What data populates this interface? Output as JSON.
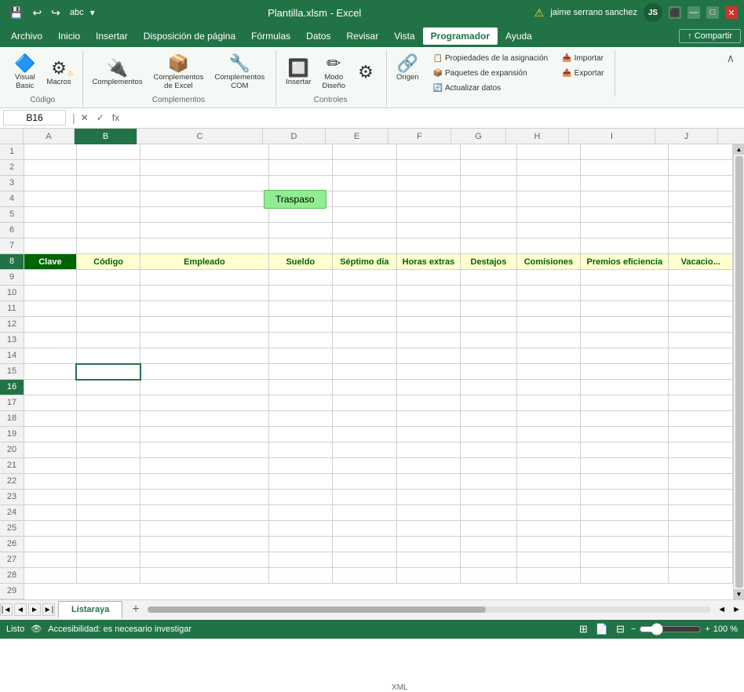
{
  "titlebar": {
    "title": "Plantilla.xlsm - Excel",
    "quick_access": [
      "💾",
      "↩",
      "↪",
      "abc"
    ],
    "user": "jaime serrano sanchez",
    "user_initials": "JS",
    "warning": "⚠",
    "minimize": "—",
    "maximize": "□",
    "close": "✕"
  },
  "menubar": {
    "items": [
      "Archivo",
      "Inicio",
      "Insertar",
      "Disposición de página",
      "Fórmulas",
      "Datos",
      "Revisar",
      "Vista",
      "Programador",
      "Ayuda"
    ],
    "active": "Programador",
    "share_label": "Compartir"
  },
  "ribbon": {
    "groups": [
      {
        "name": "Código",
        "buttons": [
          {
            "icon": "🔷",
            "label": "Visual\nBasic"
          },
          {
            "icon": "⚙",
            "label": "Macros",
            "warning": true
          }
        ]
      },
      {
        "name": "Complementos",
        "buttons": [
          {
            "icon": "🔌",
            "label": "Complementos"
          },
          {
            "icon": "📦",
            "label": "Complementos\nde Excel"
          },
          {
            "icon": "🔧",
            "label": "Complementos\nCOM"
          }
        ]
      },
      {
        "name": "Controles",
        "buttons": [
          {
            "icon": "➕",
            "label": "Insertar"
          },
          {
            "icon": "✏",
            "label": "Modo\nDiseño"
          },
          {
            "icon": "⚙",
            "label": ""
          }
        ]
      },
      {
        "name": "XML",
        "small_buttons": [
          {
            "icon": "📌",
            "label": "Propiedades de la asignación"
          },
          {
            "icon": "📦",
            "label": "Paquetes de expansión"
          },
          {
            "icon": "🔄",
            "label": "Actualizar datos"
          },
          {
            "icon": "📥",
            "label": "Importar"
          },
          {
            "icon": "📤",
            "label": "Exportar"
          }
        ],
        "main_button": {
          "icon": "🔗",
          "label": "Origen"
        }
      }
    ]
  },
  "formula_bar": {
    "cell_ref": "B16",
    "formula": ""
  },
  "spreadsheet": {
    "columns": [
      "A",
      "B",
      "C",
      "D",
      "E",
      "F",
      "G",
      "H",
      "I"
    ],
    "rows": [
      1,
      2,
      3,
      4,
      5,
      6,
      7,
      8,
      9,
      10,
      11,
      12,
      13,
      14,
      15,
      16,
      17,
      18,
      19,
      20,
      21,
      22,
      23,
      24,
      25,
      26,
      27,
      28,
      29
    ],
    "traspaso_button": "Traspaso",
    "header_row": 8,
    "headers": [
      "Clave",
      "Código",
      "Empleado",
      "Sueldo",
      "Séptimo día",
      "Horas extras",
      "Destajos",
      "Comisiones",
      "Premios eficiencia",
      "Vacacio..."
    ],
    "selected_cell": "B16"
  },
  "sheet_tabs": {
    "tabs": [
      "Listaraya"
    ],
    "active": "Listaraya"
  },
  "status_bar": {
    "status": "Listo",
    "accessibility": "Accesibilidad: es necesario investigar",
    "zoom": "100 %"
  }
}
